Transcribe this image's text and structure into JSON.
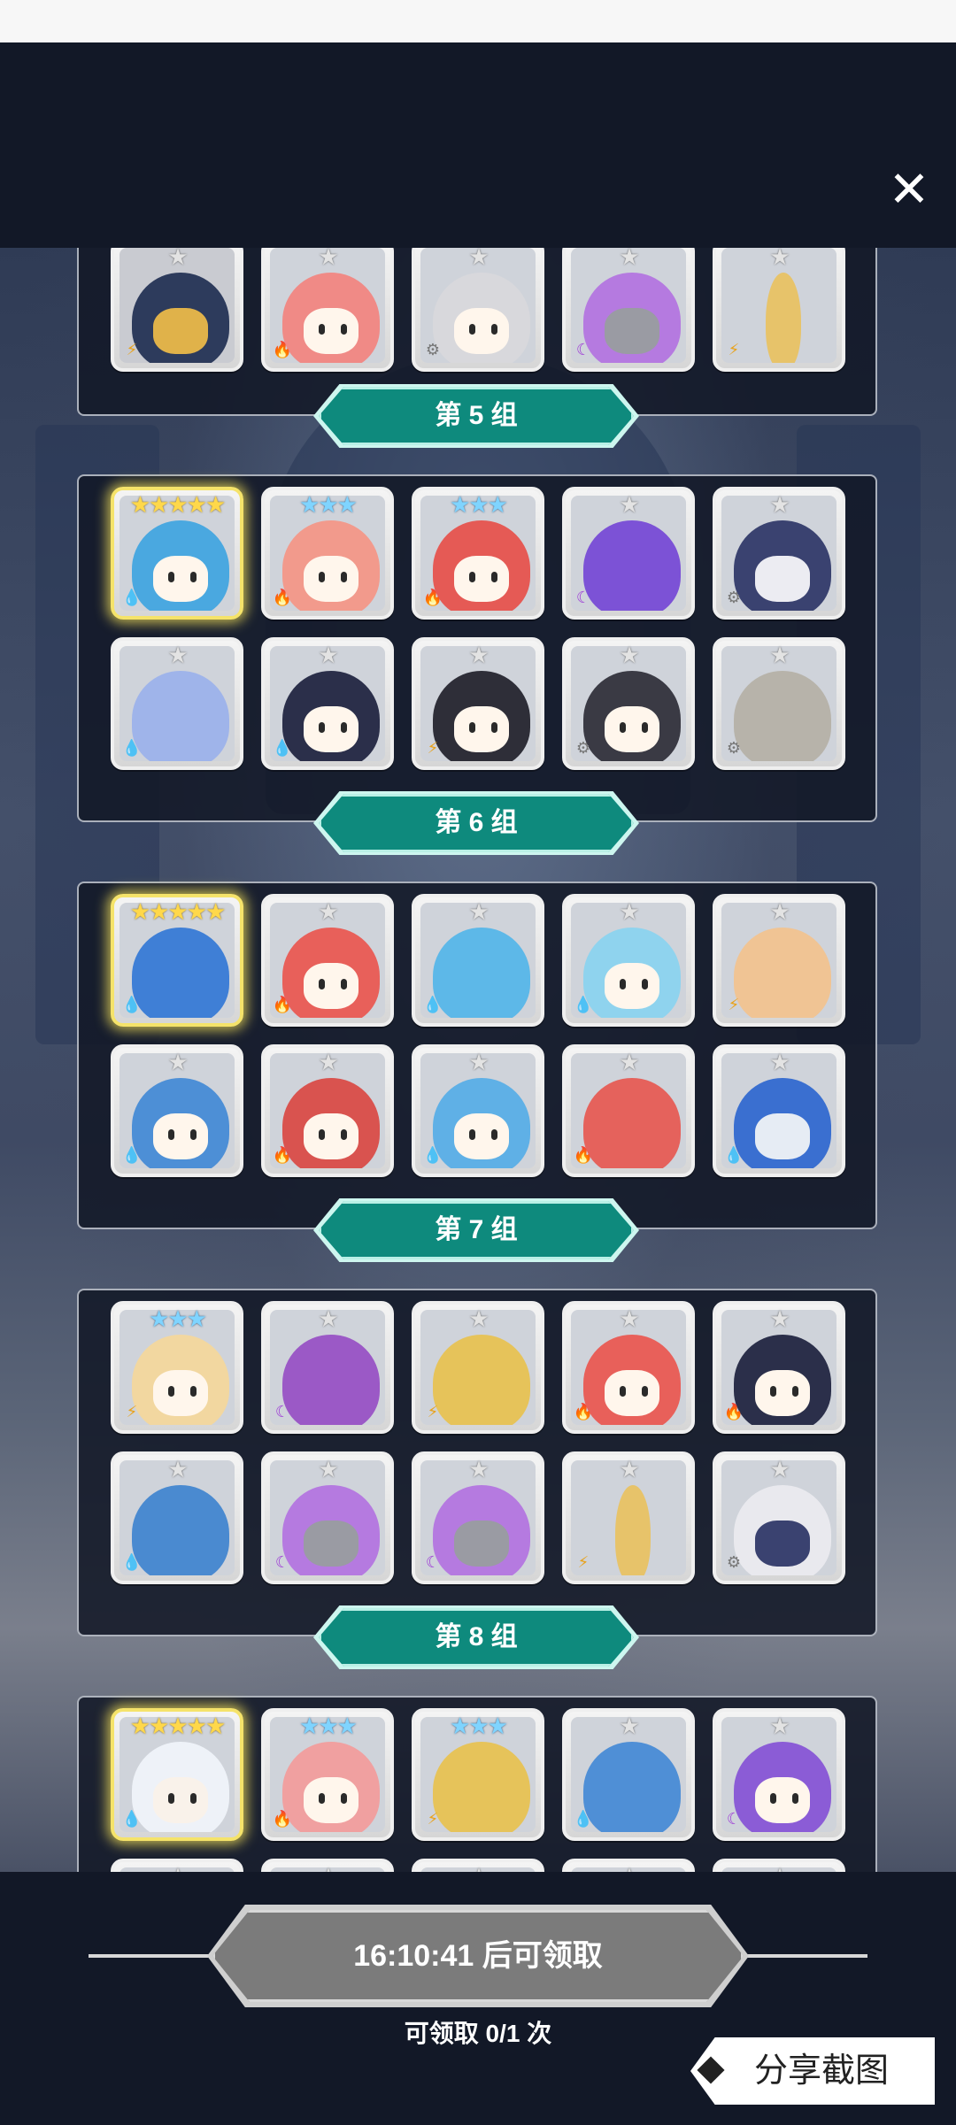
{
  "close_label": "✕",
  "groups": [
    {
      "label": "第 5 组"
    },
    {
      "label": "第 6 组"
    },
    {
      "label": "第 7 组"
    },
    {
      "label": "第 8 组"
    }
  ],
  "timer": {
    "label": "16:10:41 后可领取"
  },
  "claim": {
    "label": "可领取 0/1 次"
  },
  "share": {
    "label": "分享截图"
  },
  "star_glyphs": {
    "s1": "★",
    "s3": "★★★",
    "s5": "★★★★★"
  },
  "element_glyphs": {
    "water": "💧",
    "fire": "🔥",
    "light": "⚡",
    "dark": "☾",
    "gear": "⚙"
  }
}
